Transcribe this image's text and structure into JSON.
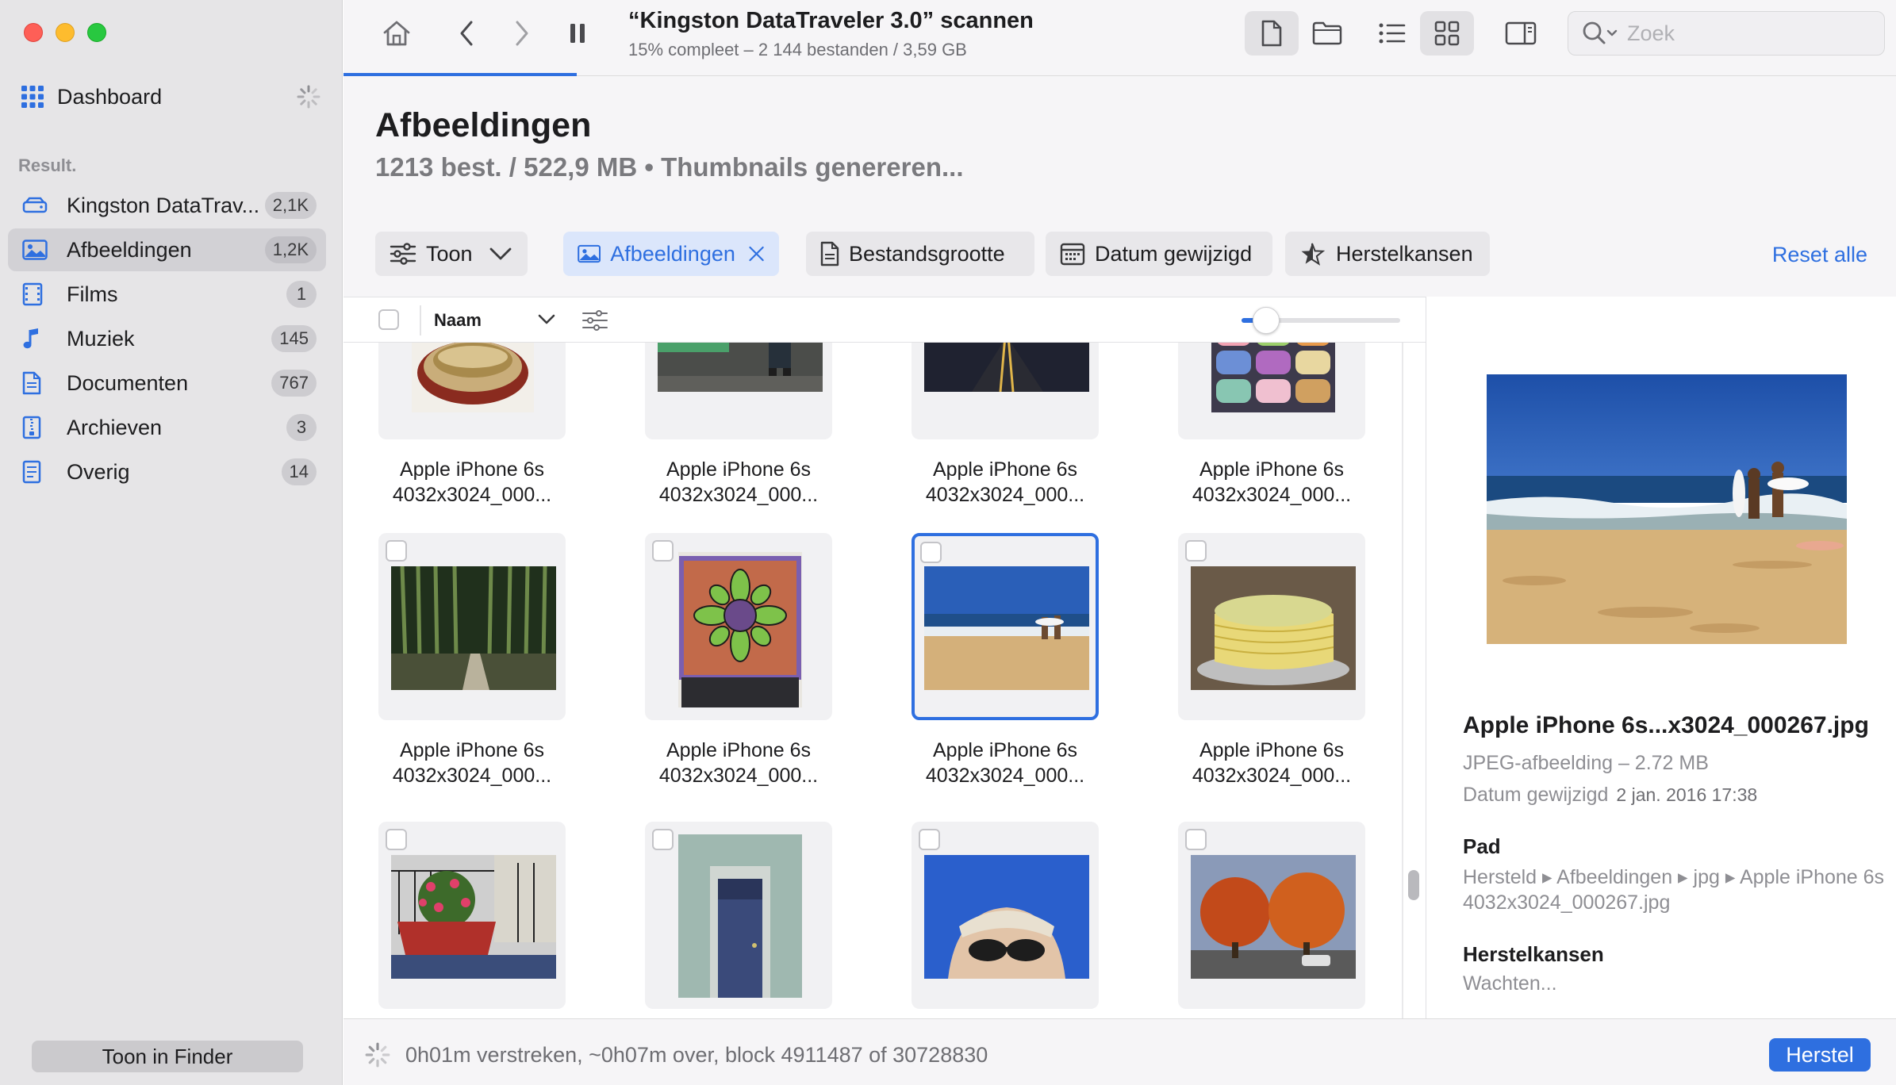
{
  "sidebar": {
    "dashboard_label": "Dashboard",
    "section_label": "Result.",
    "items": [
      {
        "label": "Kingston DataTrav...",
        "count": "2,1K",
        "icon": "drive-icon"
      },
      {
        "label": "Afbeeldingen",
        "count": "1,2K",
        "icon": "photo-icon"
      },
      {
        "label": "Films",
        "count": "1",
        "icon": "film-icon"
      },
      {
        "label": "Muziek",
        "count": "145",
        "icon": "music-note-icon"
      },
      {
        "label": "Documenten",
        "count": "767",
        "icon": "document-icon"
      },
      {
        "label": "Archieven",
        "count": "3",
        "icon": "archive-icon"
      },
      {
        "label": "Overig",
        "count": "14",
        "icon": "other-file-icon"
      }
    ],
    "finder_button": "Toon in Finder"
  },
  "toolbar": {
    "scan_title": "“Kingston DataTraveler 3.0” scannen",
    "scan_subtitle": "15% compleet – 2 144 bestanden / 3,59 GB",
    "scan_progress": 0.15,
    "search_placeholder": "Zoek"
  },
  "header": {
    "title": "Afbeeldingen",
    "subtitle": "1213 best. / 522,9 MB • Thumbnails genereren..."
  },
  "filters": {
    "show_label": "Toon",
    "active_filter": "Afbeeldingen",
    "size_label": "Bestandsgrootte",
    "date_label": "Datum gewijzigd",
    "chances_label": "Herstelkansen",
    "reset_label": "Reset alle"
  },
  "columns": {
    "name_label": "Naam"
  },
  "grid": {
    "rows": [
      [
        {
          "caption": "Apple iPhone 6s\n4032x3024_000..."
        },
        {
          "caption": "Apple iPhone 6s\n4032x3024_000..."
        },
        {
          "caption": "Apple iPhone 6s\n4032x3024_000..."
        },
        {
          "caption": "Apple iPhone 6s\n4032x3024_000..."
        }
      ],
      [
        {
          "caption": "Apple iPhone 6s\n4032x3024_000..."
        },
        {
          "caption": "Apple iPhone 6s\n4032x3024_000..."
        },
        {
          "caption": "Apple iPhone 6s\n4032x3024_000..."
        },
        {
          "caption": "Apple iPhone 6s\n4032x3024_000..."
        }
      ]
    ]
  },
  "preview": {
    "name": "Apple iPhone 6s...x3024_000267.jpg",
    "type": "JPEG-afbeelding – 2.72 MB",
    "date_label": "Datum gewijzigd",
    "date_value": "2 jan. 2016 17:38",
    "path_label": "Pad",
    "path_value": "Hersteld ▸ Afbeeldingen ▸ jpg ▸ Apple iPhone 6s 4032x3024_000267.jpg",
    "chances_label": "Herstelkansen",
    "chances_value": "Wachten..."
  },
  "status": {
    "text": "0h01m verstreken, ~0h07m over, block 4911487 of 30728830",
    "recover_button": "Herstel"
  },
  "colors": {
    "accent": "#2e6fe0",
    "sidebar_bg": "#e6e5e7"
  }
}
